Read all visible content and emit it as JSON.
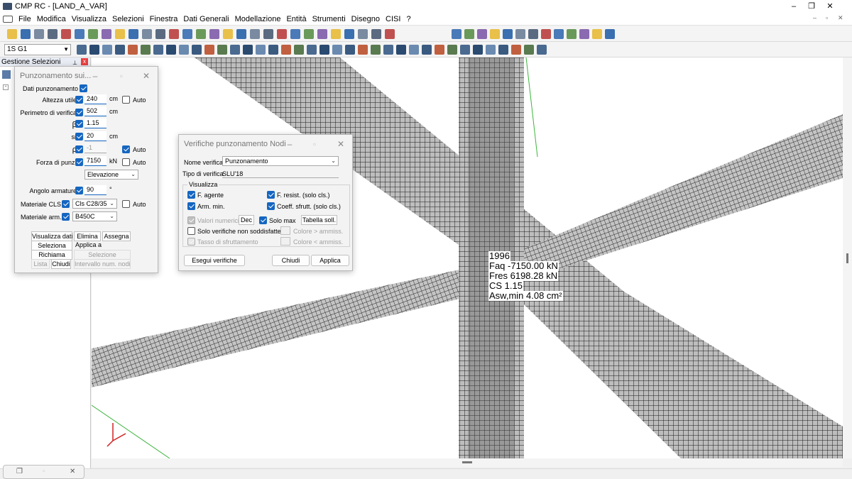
{
  "window": {
    "title": "CMP RC - [LAND_A_VAR]",
    "min": "–",
    "max": "❐",
    "close": "✕"
  },
  "menu": [
    "File",
    "Modifica",
    "Visualizza",
    "Selezioni",
    "Finestra",
    "Dati Generali",
    "Modellazione",
    "Entità",
    "Strumenti",
    "Disegno",
    "CISI",
    "?"
  ],
  "mdi_controls": {
    "min": "–",
    "restore": "▫",
    "close": "✕"
  },
  "floor_select": "1S G1",
  "left_panel": {
    "title": "Gestione Selezioni",
    "pin": "📌",
    "close": "x"
  },
  "punz_dialog": {
    "title": "Punzonamento sui...",
    "section_label": "Dati punzonamento",
    "rows": {
      "altezza": {
        "label": "Altezza utile",
        "value": "240",
        "unit": "cm",
        "auto": "Auto"
      },
      "perimetro": {
        "label": "Perimetro di verifica",
        "value": "502",
        "unit": "cm"
      },
      "beta": {
        "label": "β",
        "value": "1.15"
      },
      "sr": {
        "label": "sr",
        "value": "20",
        "unit": "cm"
      },
      "rho": {
        "label": "ρ",
        "value": "-1",
        "auto": "Auto"
      },
      "forza": {
        "label": "Forza di punz.",
        "value": "7150",
        "unit": "kN",
        "auto": "Auto"
      },
      "elevazione": "Elevazione",
      "angolo": {
        "label": "Angolo armature",
        "value": "90",
        "unit": "°"
      },
      "cls": {
        "label": "Materiale CLS",
        "value": "Cls C28/35",
        "auto": "Auto"
      },
      "arm": {
        "label": "Materiale arm.",
        "value": "B450C"
      }
    },
    "buttons": {
      "visualizza": "Visualizza dati",
      "elimina": "Elimina",
      "assegna": "Assegna",
      "seleziona": "Seleziona",
      "applica_a": "Applica a",
      "richiama": "Richiama",
      "selezione": "Selezione",
      "lista": "Lista",
      "chiudi": "Chiudi",
      "intervallo": "Intervallo num. nodi"
    }
  },
  "verif_dialog": {
    "title": "Verifiche punzonamento Nodi",
    "nome_label": "Nome verifica",
    "nome_value": "Punzonamento",
    "tipo_label": "Tipo di verifica",
    "tipo_value": "SLU'18",
    "group_label": "Visualizza",
    "f_agente": "F. agente",
    "f_resist": "F. resist. (solo cls.)",
    "arm_min": "Arm. min.",
    "coeff": "Coeff. sfrutt. (solo cls.)",
    "valori": "Valori numerici",
    "dec": "Dec",
    "solo_max": "Solo max",
    "tabella": "Tabella soll.",
    "solo_non": "Solo verifiche non soddisfatte",
    "colore_gt": "Colore > ammiss.",
    "tasso": "Tasso di sfruttamento",
    "colore_lt": "Colore < ammiss.",
    "esegui": "Esegui verifiche",
    "chiudi": "Chiudi",
    "applica": "Applica"
  },
  "tooltip": {
    "node": "1996",
    "fag": "Faq  -7150.00 kN",
    "fres": "Fres 6198.28 kN",
    "cs": "CS 1.15",
    "asw": "Asw,min 4.08 cm²"
  },
  "colors": {
    "accent": "#1566c0",
    "bg": "#f0f0f0"
  }
}
